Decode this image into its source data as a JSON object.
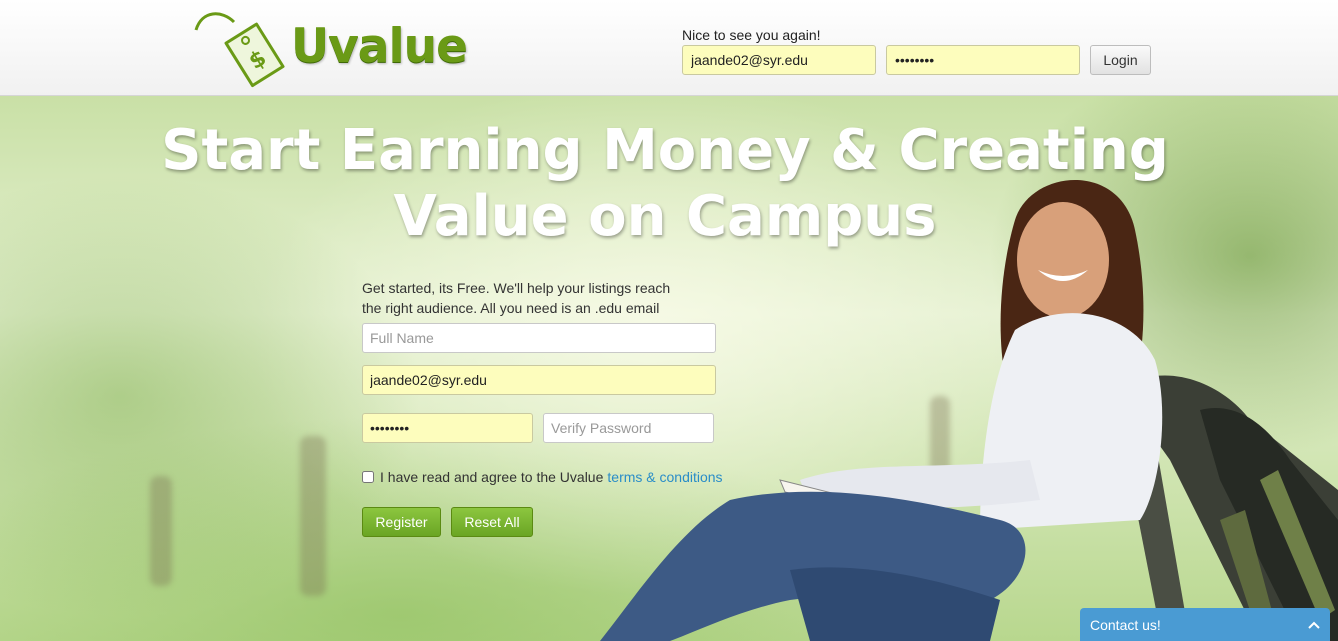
{
  "header": {
    "logo_text": "Uvalue",
    "greeting": "Nice to see you again!",
    "email_value": "jaande02@syr.edu",
    "password_value": "••••••••",
    "login_label": "Login"
  },
  "hero": {
    "headline_line1": "Start Earning Money & Creating",
    "headline_line2": "Value on Campus"
  },
  "form": {
    "intro": "Get started, its Free. We'll help your listings reach the right audience. All you need is an .edu email",
    "full_name_placeholder": "Full Name",
    "email_value": "jaande02@syr.edu",
    "password_value": "••••••••",
    "verify_placeholder": "Verify Password",
    "agree_text": "I have read and agree to the Uvalue",
    "terms_link": "terms & conditions",
    "register_label": "Register",
    "reset_label": "Reset All"
  },
  "contact": {
    "label": "Contact us!",
    "icon": "chevron-up-icon"
  },
  "colors": {
    "brand_green": "#6a9a16",
    "button_green": "#7ab833",
    "autofill_yellow": "#fdfdbd",
    "link_blue": "#2a8dc8",
    "contact_blue": "#4a9bd3"
  }
}
